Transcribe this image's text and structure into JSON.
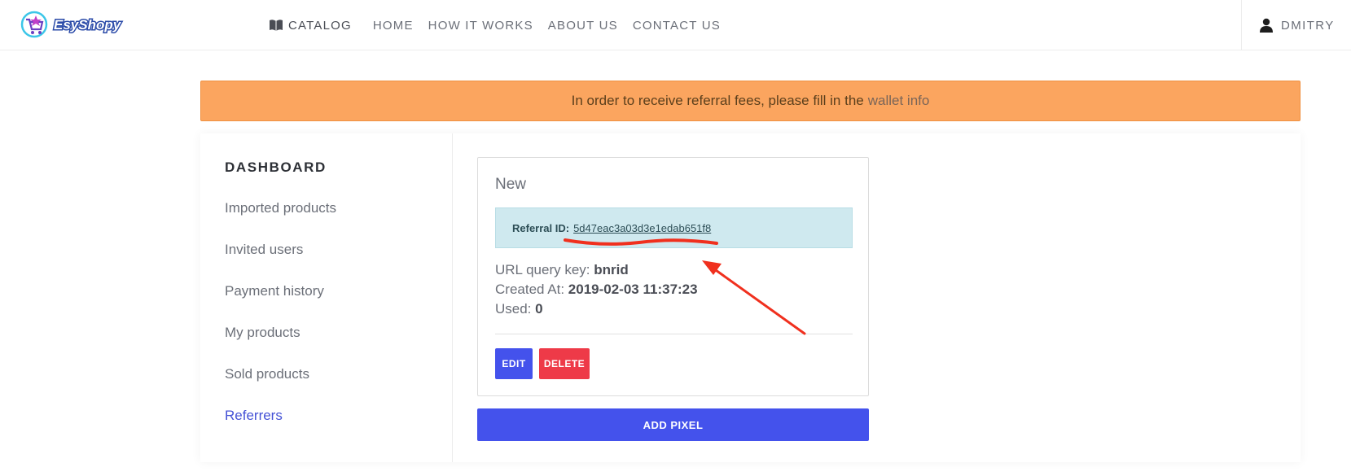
{
  "header": {
    "logo_text": "EsyShopy",
    "nav": [
      {
        "label": "CATALOG",
        "icon": "book-icon"
      },
      {
        "label": "HOME"
      },
      {
        "label": "HOW IT WORKS"
      },
      {
        "label": "ABOUT US"
      },
      {
        "label": "CONTACT US"
      }
    ],
    "user": {
      "name": "DMITRY",
      "icon": "user-icon"
    }
  },
  "alert": {
    "text": "In order to receive referral fees, please fill in the",
    "link": "wallet info",
    "color": "#fba55f"
  },
  "sidebar": {
    "title": "DASHBOARD",
    "items": [
      {
        "label": "Imported products"
      },
      {
        "label": "Invited users"
      },
      {
        "label": "Payment history"
      },
      {
        "label": "My products"
      },
      {
        "label": "Sold products"
      },
      {
        "label": "Referrers",
        "active": true
      }
    ]
  },
  "referrer": {
    "title": "New",
    "referral_id_label": "Referral ID:",
    "referral_id": "5d47eac3a03d3e1edab651f8",
    "url_key_label": "URL query key:",
    "url_key": "bnrid",
    "created_label": "Created At:",
    "created": "2019-02-03 11:37:23",
    "used_label": "Used:",
    "used": "0",
    "edit_label": "EDIT",
    "delete_label": "DELETE"
  },
  "add_pixel_label": "ADD PIXEL",
  "colors": {
    "primary": "#4452ec",
    "danger": "#ee3a48",
    "annotation": "#f0301e"
  }
}
